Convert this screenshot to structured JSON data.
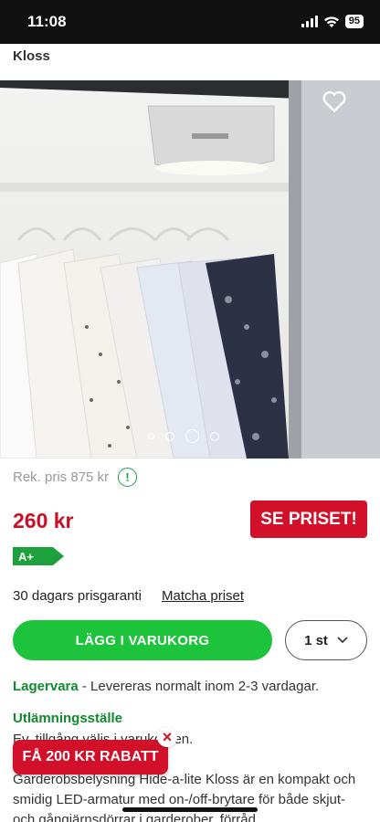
{
  "status": {
    "time": "11:08",
    "battery": "95"
  },
  "header": {
    "title": "Kloss"
  },
  "product": {
    "image_alt": "Garderobsbelysning Hide-a-lite Kloss",
    "image_brand": "hide-a-lite",
    "carousel": {
      "count": 4,
      "active_index": 2
    }
  },
  "pricing": {
    "rek_price": "Rek. pris 875 kr",
    "price": "260 kr",
    "see_price_label": "SE PRISET!",
    "energy_class": "A+"
  },
  "guarantee": {
    "text": "30 dagars prisgaranti",
    "match_link": "Matcha priset"
  },
  "cart": {
    "add_label": "LÄGG I VARUKORG",
    "quantity": "1 st"
  },
  "stock": {
    "label": "Lagervara",
    "text": " - Levereras normalt inom 2-3 vardagar."
  },
  "pickup": {
    "title": "Utlämningsställe",
    "text": "Ev. tillgång väljs i varukorgen."
  },
  "description": "Garderobsbelysning Hide-a-lite Kloss är en kompakt och smidig LED-armatur med on-/off-brytare för både skjut- och gångjärnsdörrar i garderober, förråd",
  "promo": {
    "label": "FÅ 200 KR RABATT"
  },
  "colors": {
    "green": "#1ec33c",
    "red": "#d3102a",
    "price_red": "#c90f26",
    "dark_green": "#0f8a2f"
  },
  "icons": [
    "signal-icon",
    "wifi-icon",
    "battery-icon",
    "heart-icon",
    "info-icon",
    "chevron-down-icon",
    "close-icon"
  ]
}
